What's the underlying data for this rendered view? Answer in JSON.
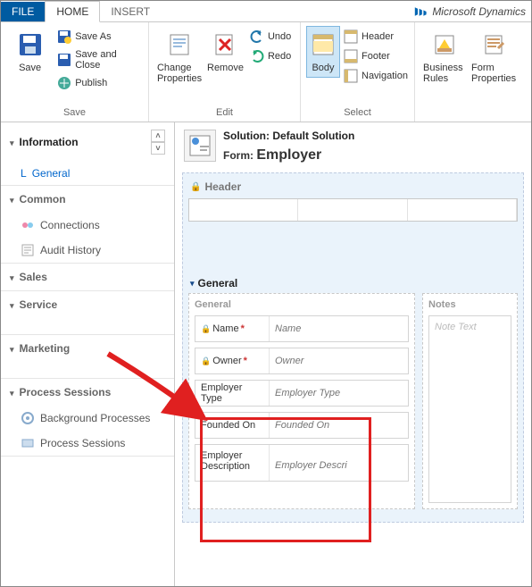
{
  "brand": "Microsoft Dynamics",
  "tabs": {
    "file": "FILE",
    "home": "HOME",
    "insert": "INSERT"
  },
  "ribbon": {
    "save": {
      "save": "Save",
      "save_as": "Save As",
      "save_close": "Save and Close",
      "publish": "Publish",
      "group": "Save"
    },
    "edit": {
      "change_props": "Change Properties",
      "remove": "Remove",
      "undo": "Undo",
      "redo": "Redo",
      "group": "Edit"
    },
    "select": {
      "body": "Body",
      "header": "Header",
      "footer": "Footer",
      "navigation": "Navigation",
      "group": "Select"
    },
    "extra": {
      "biz_rules": "Business Rules",
      "form_props": "Form Properties"
    }
  },
  "nav": {
    "information": "Information",
    "general": "General",
    "common": "Common",
    "connections": "Connections",
    "audit": "Audit History",
    "sales": "Sales",
    "service": "Service",
    "marketing": "Marketing",
    "process_sessions": "Process Sessions",
    "bg_processes": "Background Processes",
    "process_sessions_item": "Process Sessions"
  },
  "form": {
    "solution_label": "Solution:",
    "solution_value": "Default Solution",
    "form_label": "Form:",
    "form_value": "Employer",
    "header_section": "Header",
    "general_section": "General",
    "general_col": "General",
    "notes_col": "Notes",
    "fields": {
      "name": {
        "label": "Name",
        "ph": "Name"
      },
      "owner": {
        "label": "Owner",
        "ph": "Owner"
      },
      "emp_type": {
        "label": "Employer Type",
        "ph": "Employer Type"
      },
      "founded": {
        "label": "Founded On",
        "ph": "Founded On"
      },
      "desc": {
        "label": "Employer Description",
        "ph": "Employer Descri"
      }
    },
    "notes_ph": "Note Text"
  }
}
